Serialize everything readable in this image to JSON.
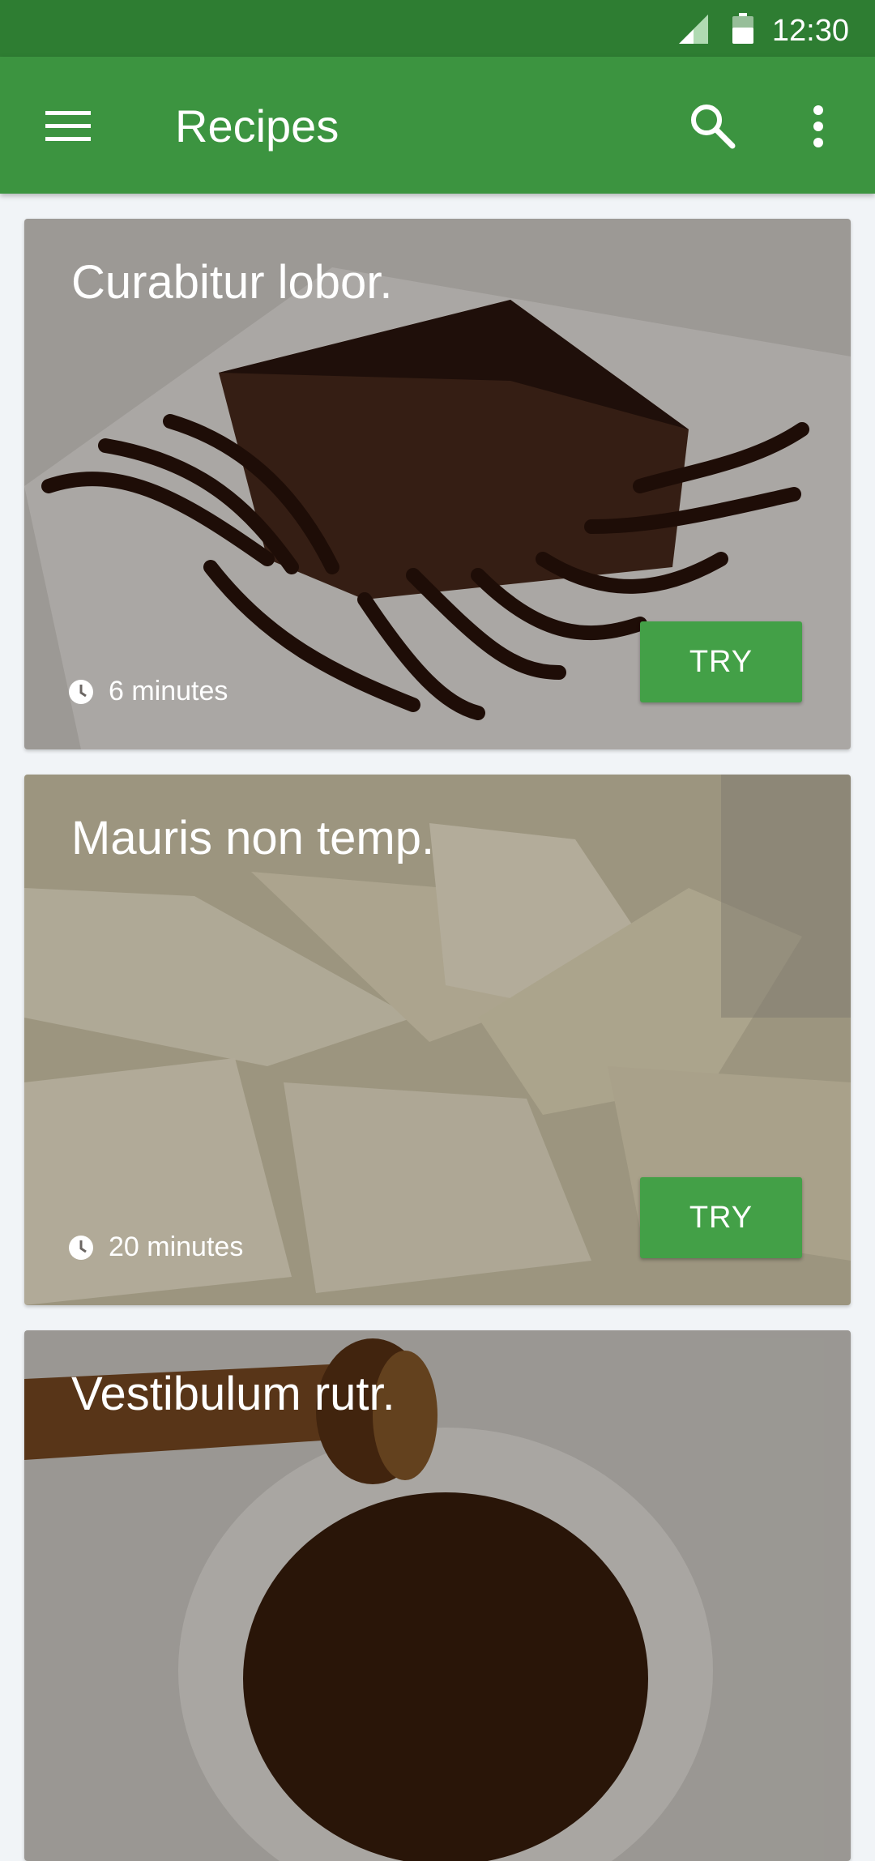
{
  "status_bar": {
    "time": "12:30"
  },
  "app_bar": {
    "title": "Recipes"
  },
  "cards": [
    {
      "title": "Curabitur lobor.",
      "duration": "6 minutes",
      "action_label": "TRY"
    },
    {
      "title": "Mauris non temp.",
      "duration": "20 minutes",
      "action_label": "TRY"
    },
    {
      "title": "Vestibulum rutr."
    }
  ],
  "colors": {
    "status_bar": "#2e7d32",
    "app_bar": "#3c9440",
    "accent_button": "#43a047",
    "background": "#f1f4f7"
  },
  "icons": [
    "signal-icon",
    "battery-icon",
    "menu-icon",
    "search-icon",
    "more-vert-icon",
    "clock-icon"
  ]
}
